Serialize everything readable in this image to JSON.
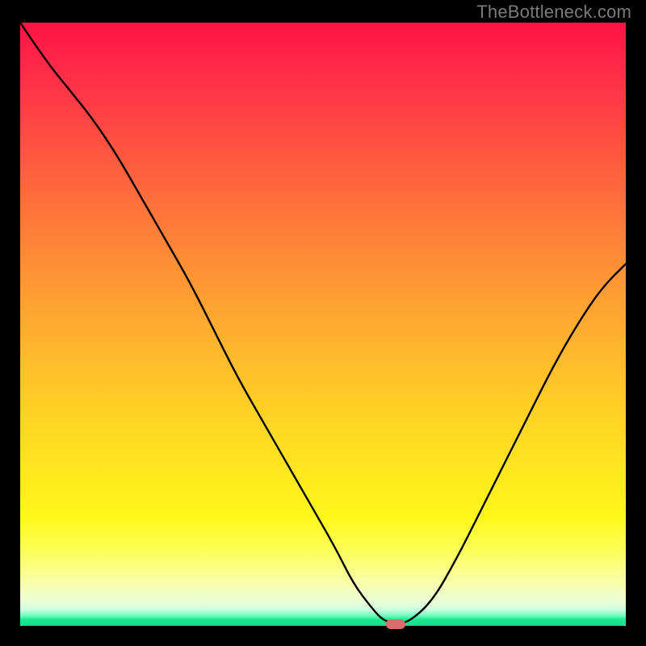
{
  "watermark": "TheBottleneck.com",
  "chart_data": {
    "type": "line",
    "title": "",
    "xlabel": "",
    "ylabel": "",
    "xlim": [
      0,
      100
    ],
    "ylim": [
      0,
      100
    ],
    "grid": false,
    "legend": false,
    "series": [
      {
        "name": "bottleneck-curve",
        "x": [
          0,
          4,
          8,
          12,
          16,
          20,
          24,
          28,
          32,
          36,
          40,
          44,
          48,
          52,
          55,
          58,
          60,
          62,
          64,
          68,
          72,
          76,
          80,
          84,
          88,
          92,
          96,
          100
        ],
        "y": [
          100,
          94,
          89,
          84,
          78,
          71,
          64,
          57,
          49,
          41,
          34,
          27,
          20,
          13,
          7,
          3,
          0.8,
          0.5,
          0.5,
          4,
          11,
          19,
          27,
          35,
          43,
          50,
          56,
          60
        ]
      }
    ],
    "marker": {
      "x": 62,
      "y": 0.3
    },
    "background_gradient": {
      "top": "#ff1345",
      "mid": "#ffd524",
      "bottom": "#12df8b"
    }
  }
}
